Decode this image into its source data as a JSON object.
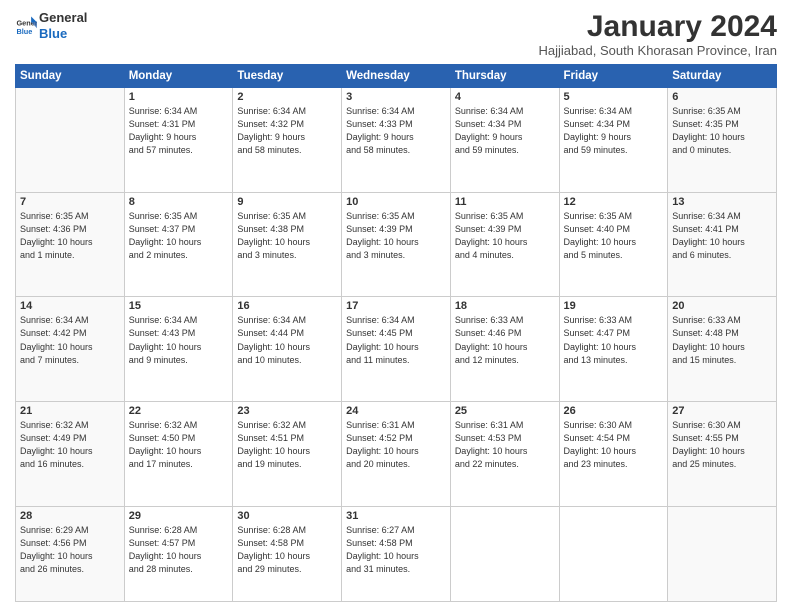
{
  "logo": {
    "general": "General",
    "blue": "Blue"
  },
  "header": {
    "month": "January 2024",
    "location": "Hajjiabad, South Khorasan Province, Iran"
  },
  "days_of_week": [
    "Sunday",
    "Monday",
    "Tuesday",
    "Wednesday",
    "Thursday",
    "Friday",
    "Saturday"
  ],
  "weeks": [
    [
      {
        "day": "",
        "info": ""
      },
      {
        "day": "1",
        "info": "Sunrise: 6:34 AM\nSunset: 4:31 PM\nDaylight: 9 hours\nand 57 minutes."
      },
      {
        "day": "2",
        "info": "Sunrise: 6:34 AM\nSunset: 4:32 PM\nDaylight: 9 hours\nand 58 minutes."
      },
      {
        "day": "3",
        "info": "Sunrise: 6:34 AM\nSunset: 4:33 PM\nDaylight: 9 hours\nand 58 minutes."
      },
      {
        "day": "4",
        "info": "Sunrise: 6:34 AM\nSunset: 4:34 PM\nDaylight: 9 hours\nand 59 minutes."
      },
      {
        "day": "5",
        "info": "Sunrise: 6:34 AM\nSunset: 4:34 PM\nDaylight: 9 hours\nand 59 minutes."
      },
      {
        "day": "6",
        "info": "Sunrise: 6:35 AM\nSunset: 4:35 PM\nDaylight: 10 hours\nand 0 minutes."
      }
    ],
    [
      {
        "day": "7",
        "info": "Sunrise: 6:35 AM\nSunset: 4:36 PM\nDaylight: 10 hours\nand 1 minute."
      },
      {
        "day": "8",
        "info": "Sunrise: 6:35 AM\nSunset: 4:37 PM\nDaylight: 10 hours\nand 2 minutes."
      },
      {
        "day": "9",
        "info": "Sunrise: 6:35 AM\nSunset: 4:38 PM\nDaylight: 10 hours\nand 3 minutes."
      },
      {
        "day": "10",
        "info": "Sunrise: 6:35 AM\nSunset: 4:39 PM\nDaylight: 10 hours\nand 3 minutes."
      },
      {
        "day": "11",
        "info": "Sunrise: 6:35 AM\nSunset: 4:39 PM\nDaylight: 10 hours\nand 4 minutes."
      },
      {
        "day": "12",
        "info": "Sunrise: 6:35 AM\nSunset: 4:40 PM\nDaylight: 10 hours\nand 5 minutes."
      },
      {
        "day": "13",
        "info": "Sunrise: 6:34 AM\nSunset: 4:41 PM\nDaylight: 10 hours\nand 6 minutes."
      }
    ],
    [
      {
        "day": "14",
        "info": "Sunrise: 6:34 AM\nSunset: 4:42 PM\nDaylight: 10 hours\nand 7 minutes."
      },
      {
        "day": "15",
        "info": "Sunrise: 6:34 AM\nSunset: 4:43 PM\nDaylight: 10 hours\nand 9 minutes."
      },
      {
        "day": "16",
        "info": "Sunrise: 6:34 AM\nSunset: 4:44 PM\nDaylight: 10 hours\nand 10 minutes."
      },
      {
        "day": "17",
        "info": "Sunrise: 6:34 AM\nSunset: 4:45 PM\nDaylight: 10 hours\nand 11 minutes."
      },
      {
        "day": "18",
        "info": "Sunrise: 6:33 AM\nSunset: 4:46 PM\nDaylight: 10 hours\nand 12 minutes."
      },
      {
        "day": "19",
        "info": "Sunrise: 6:33 AM\nSunset: 4:47 PM\nDaylight: 10 hours\nand 13 minutes."
      },
      {
        "day": "20",
        "info": "Sunrise: 6:33 AM\nSunset: 4:48 PM\nDaylight: 10 hours\nand 15 minutes."
      }
    ],
    [
      {
        "day": "21",
        "info": "Sunrise: 6:32 AM\nSunset: 4:49 PM\nDaylight: 10 hours\nand 16 minutes."
      },
      {
        "day": "22",
        "info": "Sunrise: 6:32 AM\nSunset: 4:50 PM\nDaylight: 10 hours\nand 17 minutes."
      },
      {
        "day": "23",
        "info": "Sunrise: 6:32 AM\nSunset: 4:51 PM\nDaylight: 10 hours\nand 19 minutes."
      },
      {
        "day": "24",
        "info": "Sunrise: 6:31 AM\nSunset: 4:52 PM\nDaylight: 10 hours\nand 20 minutes."
      },
      {
        "day": "25",
        "info": "Sunrise: 6:31 AM\nSunset: 4:53 PM\nDaylight: 10 hours\nand 22 minutes."
      },
      {
        "day": "26",
        "info": "Sunrise: 6:30 AM\nSunset: 4:54 PM\nDaylight: 10 hours\nand 23 minutes."
      },
      {
        "day": "27",
        "info": "Sunrise: 6:30 AM\nSunset: 4:55 PM\nDaylight: 10 hours\nand 25 minutes."
      }
    ],
    [
      {
        "day": "28",
        "info": "Sunrise: 6:29 AM\nSunset: 4:56 PM\nDaylight: 10 hours\nand 26 minutes."
      },
      {
        "day": "29",
        "info": "Sunrise: 6:28 AM\nSunset: 4:57 PM\nDaylight: 10 hours\nand 28 minutes."
      },
      {
        "day": "30",
        "info": "Sunrise: 6:28 AM\nSunset: 4:58 PM\nDaylight: 10 hours\nand 29 minutes."
      },
      {
        "day": "31",
        "info": "Sunrise: 6:27 AM\nSunset: 4:58 PM\nDaylight: 10 hours\nand 31 minutes."
      },
      {
        "day": "",
        "info": ""
      },
      {
        "day": "",
        "info": ""
      },
      {
        "day": "",
        "info": ""
      }
    ]
  ]
}
